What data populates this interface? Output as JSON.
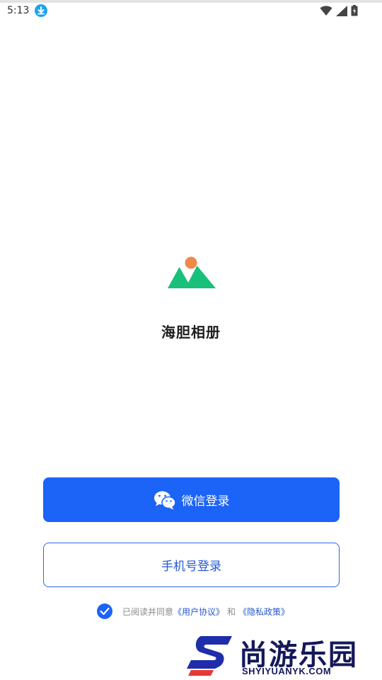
{
  "status_bar": {
    "time": "5:13",
    "icons": [
      "download-icon",
      "wifi-icon",
      "signal-icon",
      "battery-icon"
    ]
  },
  "app": {
    "name": "海胆相册",
    "logo": "mountain-sun-logo",
    "logo_colors": {
      "mountain": "#19c07a",
      "sun": "#f0884a"
    }
  },
  "login": {
    "wechat_label": "微信登录",
    "phone_label": "手机号登录",
    "primary_color": "#1c63f7"
  },
  "agreement": {
    "checked": true,
    "prefix": "已阅读并同意",
    "user_agreement": "《用户协议》",
    "conjunction": "和",
    "privacy_policy": "《隐私政策》"
  },
  "watermark": {
    "cn": "尚游乐园",
    "en": "SHYIYUANYK.COM"
  }
}
